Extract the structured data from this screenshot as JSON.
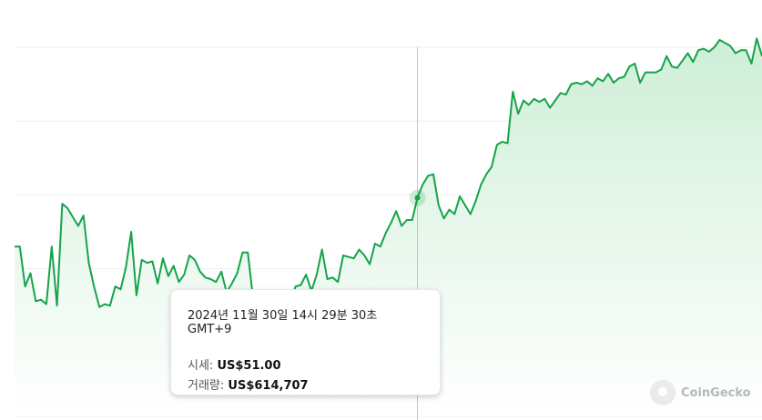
{
  "colors": {
    "line": "#16a34a",
    "area_top": "#cdeed6",
    "area_bottom": "#ffffff",
    "grid": "#eceef0",
    "crosshair": "#bfc3c7"
  },
  "tooltip": {
    "time": "2024년 11월 30일 14시 29분 30초 GMT+9",
    "price_label": "시세: ",
    "price_value": "US$51.00",
    "volume_label": "거래량: ",
    "volume_value": "US$614,707"
  },
  "logo": {
    "text": "CoinGecko",
    "icon": "gecko-logo-icon"
  },
  "chart_data": {
    "type": "area",
    "currency": "USD",
    "ylim": [
      45,
      70
    ],
    "grid": true,
    "hover_index": 76,
    "values": [
      56.5,
      56.5,
      53.8,
      54.7,
      52.8,
      52.9,
      52.6,
      56.5,
      52.5,
      59.4,
      59.1,
      58.5,
      57.9,
      58.6,
      55.4,
      53.8,
      52.4,
      52.6,
      52.5,
      53.8,
      53.6,
      55.1,
      57.5,
      53.2,
      55.6,
      55.4,
      55.5,
      54.0,
      55.7,
      54.5,
      55.2,
      54.1,
      54.6,
      55.9,
      55.6,
      54.8,
      54.4,
      54.3,
      54.1,
      54.8,
      53.4,
      54.0,
      54.7,
      56.1,
      56.1,
      53.0,
      51.8,
      51.5,
      52.1,
      51.0,
      52.2,
      52.5,
      52.7,
      53.8,
      53.9,
      54.6,
      53.5,
      54.6,
      56.3,
      54.3,
      54.4,
      54.1,
      55.9,
      55.8,
      55.7,
      56.3,
      55.9,
      55.3,
      56.7,
      56.5,
      57.4,
      58.1,
      58.9,
      57.9,
      58.3,
      58.3,
      59.8,
      60.7,
      61.3,
      61.4,
      59.3,
      58.4,
      59.0,
      58.7,
      59.9,
      59.3,
      58.7,
      59.6,
      60.7,
      61.4,
      61.9,
      63.4,
      63.6,
      63.5,
      67.0,
      65.5,
      66.4,
      66.1,
      66.5,
      66.3,
      66.5,
      65.9,
      66.4,
      66.9,
      66.8,
      67.5,
      67.6,
      67.5,
      67.7,
      67.4,
      67.9,
      67.7,
      68.2,
      67.6,
      67.9,
      68.0,
      68.7,
      68.9,
      67.6,
      68.3,
      68.3,
      68.3,
      68.5,
      69.4,
      68.7,
      68.6,
      69.1,
      69.6,
      69.0,
      69.8,
      69.9,
      69.7,
      70.0,
      70.5,
      70.3,
      70.1,
      69.6,
      69.8,
      69.8,
      68.9,
      70.6,
      69.4
    ],
    "values_note": ""
  }
}
